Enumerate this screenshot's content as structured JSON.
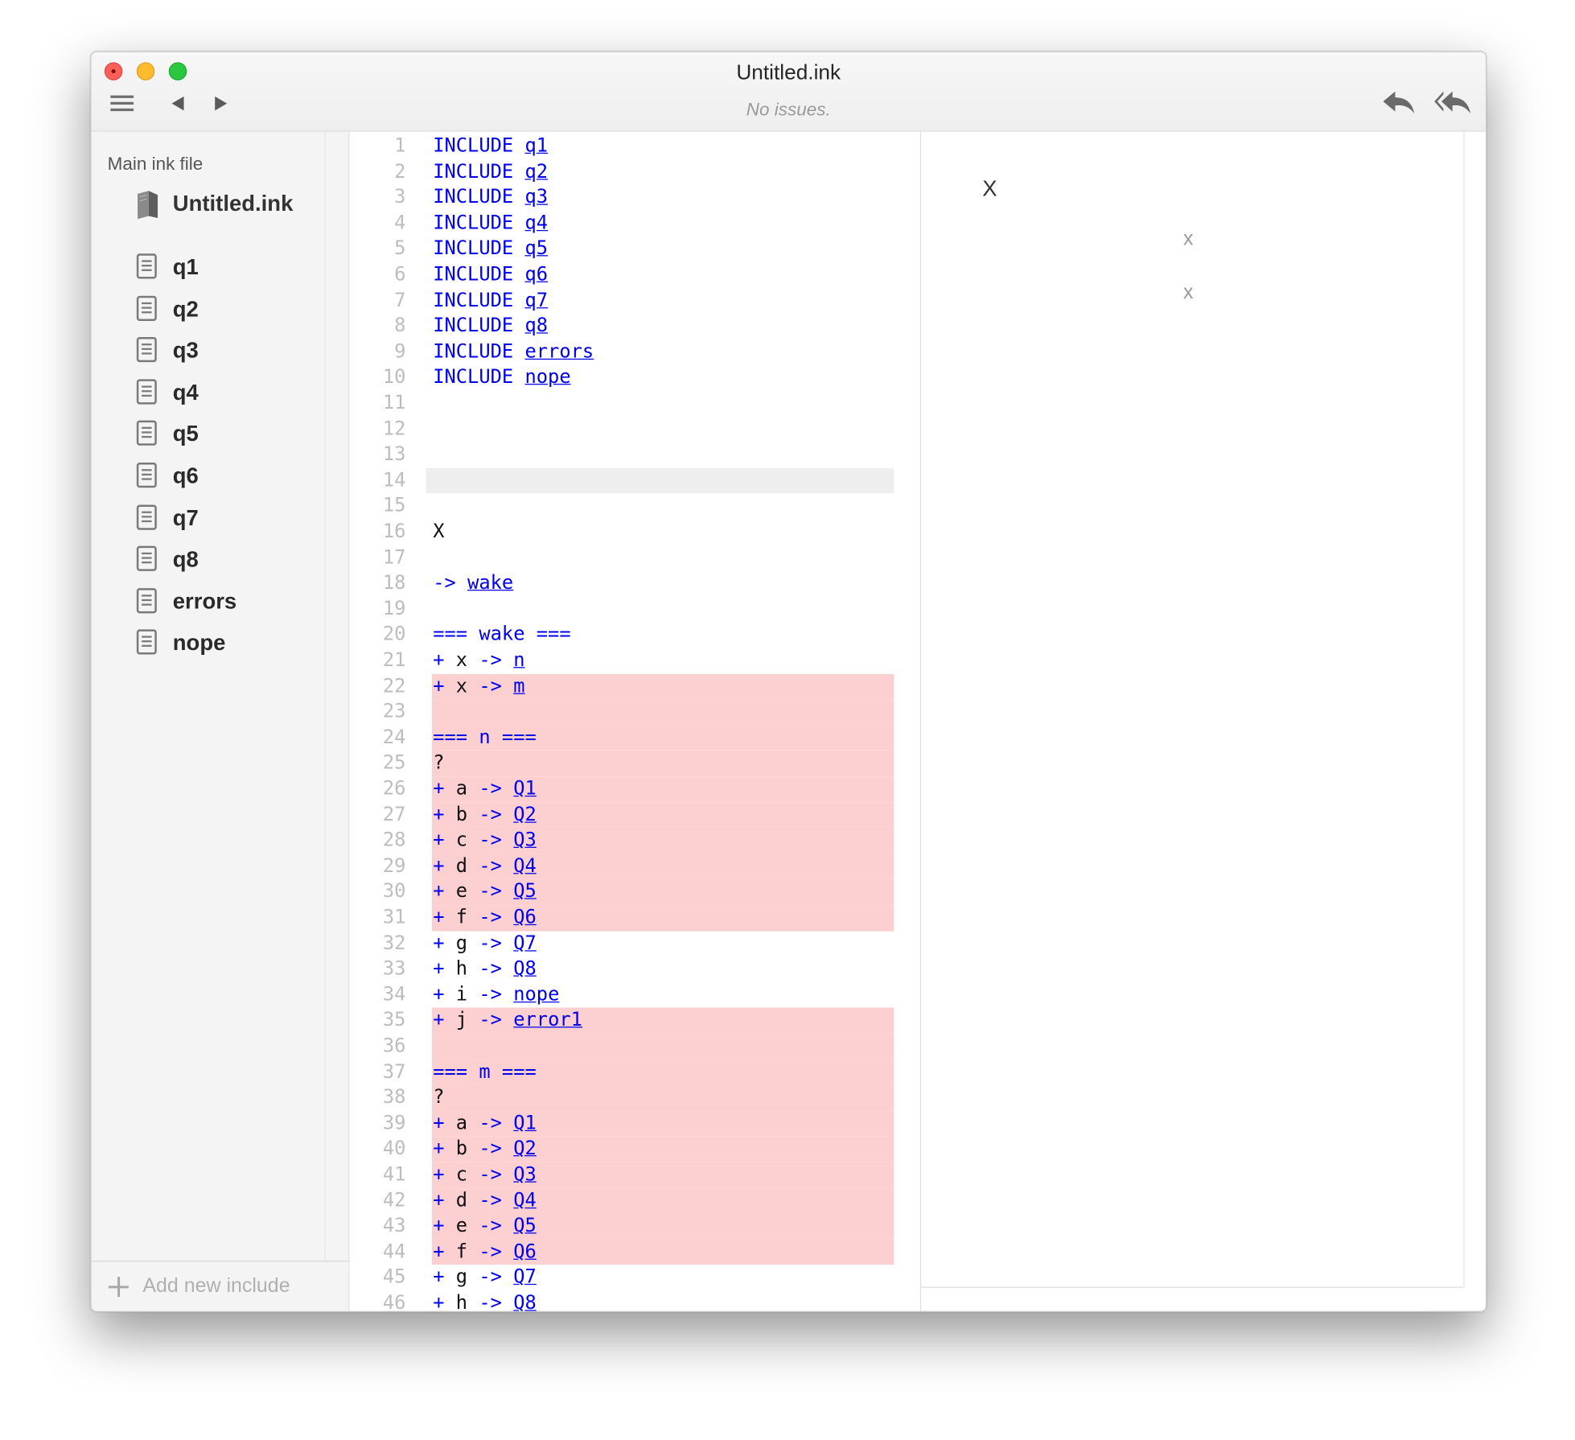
{
  "window": {
    "title": "Untitled.ink",
    "status": "No issues."
  },
  "toolbar": {
    "menu_icon": "hamburger-icon",
    "back_icon": "triangle-left-icon",
    "forward_icon": "triangle-right-icon",
    "rewind_one_icon": "undo-arrow-icon",
    "rewind_all_icon": "double-undo-arrow-icon"
  },
  "sidebar": {
    "heading": "Main ink file",
    "main_file": "Untitled.ink",
    "includes": [
      "q1",
      "q2",
      "q3",
      "q4",
      "q5",
      "q6",
      "q7",
      "q8",
      "errors",
      "nope"
    ],
    "add_label": "Add new include"
  },
  "editor": {
    "lines": [
      {
        "n": "1",
        "seg": [
          [
            "kw",
            "INCLUDE "
          ],
          [
            "lk",
            "q1"
          ]
        ]
      },
      {
        "n": "2",
        "seg": [
          [
            "kw",
            "INCLUDE "
          ],
          [
            "lk",
            "q2"
          ]
        ]
      },
      {
        "n": "3",
        "seg": [
          [
            "kw",
            "INCLUDE "
          ],
          [
            "lk",
            "q3"
          ]
        ]
      },
      {
        "n": "4",
        "seg": [
          [
            "kw",
            "INCLUDE "
          ],
          [
            "lk",
            "q4"
          ]
        ]
      },
      {
        "n": "5",
        "seg": [
          [
            "kw",
            "INCLUDE "
          ],
          [
            "lk",
            "q5"
          ]
        ]
      },
      {
        "n": "6",
        "seg": [
          [
            "kw",
            "INCLUDE "
          ],
          [
            "lk",
            "q6"
          ]
        ]
      },
      {
        "n": "7",
        "seg": [
          [
            "kw",
            "INCLUDE "
          ],
          [
            "lk",
            "q7"
          ]
        ]
      },
      {
        "n": "8",
        "seg": [
          [
            "kw",
            "INCLUDE "
          ],
          [
            "lk",
            "q8"
          ]
        ]
      },
      {
        "n": "9",
        "seg": [
          [
            "kw",
            "INCLUDE "
          ],
          [
            "lk",
            "errors"
          ]
        ]
      },
      {
        "n": "10",
        "seg": [
          [
            "kw",
            "INCLUDE "
          ],
          [
            "lk",
            "nope"
          ]
        ]
      },
      {
        "n": "11",
        "seg": []
      },
      {
        "n": "12",
        "seg": []
      },
      {
        "n": "13",
        "seg": []
      },
      {
        "n": "14",
        "seg": [],
        "current": true
      },
      {
        "n": "15",
        "seg": []
      },
      {
        "n": "16",
        "seg": [
          [
            "tx",
            "X"
          ]
        ]
      },
      {
        "n": "17",
        "seg": []
      },
      {
        "n": "18",
        "seg": [
          [
            "kw",
            "-> "
          ],
          [
            "lk",
            "wake"
          ]
        ]
      },
      {
        "n": "19",
        "seg": []
      },
      {
        "n": "20",
        "seg": [
          [
            "kw",
            "=== wake ==="
          ]
        ]
      },
      {
        "n": "21",
        "seg": [
          [
            "kw",
            "+ "
          ],
          [
            "tx",
            "x "
          ],
          [
            "kw",
            "-> "
          ],
          [
            "lk",
            "n"
          ]
        ]
      },
      {
        "n": "22",
        "seg": [
          [
            "kw",
            "+ "
          ],
          [
            "tx",
            "x "
          ],
          [
            "kw",
            "-> "
          ],
          [
            "lk",
            "m"
          ]
        ],
        "error": true
      },
      {
        "n": "23",
        "seg": [],
        "error": true
      },
      {
        "n": "24",
        "seg": [
          [
            "kw",
            "=== n ==="
          ]
        ],
        "error": true
      },
      {
        "n": "25",
        "seg": [
          [
            "tx",
            "?"
          ]
        ],
        "error": true
      },
      {
        "n": "26",
        "seg": [
          [
            "kw",
            "+ "
          ],
          [
            "tx",
            "a "
          ],
          [
            "kw",
            "-> "
          ],
          [
            "lk",
            "Q1"
          ]
        ],
        "error": true
      },
      {
        "n": "27",
        "seg": [
          [
            "kw",
            "+ "
          ],
          [
            "tx",
            "b "
          ],
          [
            "kw",
            "-> "
          ],
          [
            "lk",
            "Q2"
          ]
        ],
        "error": true
      },
      {
        "n": "28",
        "seg": [
          [
            "kw",
            "+ "
          ],
          [
            "tx",
            "c "
          ],
          [
            "kw",
            "-> "
          ],
          [
            "lk",
            "Q3"
          ]
        ],
        "error": true
      },
      {
        "n": "29",
        "seg": [
          [
            "kw",
            "+ "
          ],
          [
            "tx",
            "d "
          ],
          [
            "kw",
            "-> "
          ],
          [
            "lk",
            "Q4"
          ]
        ],
        "error": true
      },
      {
        "n": "30",
        "seg": [
          [
            "kw",
            "+ "
          ],
          [
            "tx",
            "e "
          ],
          [
            "kw",
            "-> "
          ],
          [
            "lk",
            "Q5"
          ]
        ],
        "error": true
      },
      {
        "n": "31",
        "seg": [
          [
            "kw",
            "+ "
          ],
          [
            "tx",
            "f "
          ],
          [
            "kw",
            "-> "
          ],
          [
            "lk",
            "Q6"
          ]
        ],
        "error": true
      },
      {
        "n": "32",
        "seg": [
          [
            "kw",
            "+ "
          ],
          [
            "tx",
            "g "
          ],
          [
            "kw",
            "-> "
          ],
          [
            "lk",
            "Q7"
          ]
        ]
      },
      {
        "n": "33",
        "seg": [
          [
            "kw",
            "+ "
          ],
          [
            "tx",
            "h "
          ],
          [
            "kw",
            "-> "
          ],
          [
            "lk",
            "Q8"
          ]
        ]
      },
      {
        "n": "34",
        "seg": [
          [
            "kw",
            "+ "
          ],
          [
            "tx",
            "i "
          ],
          [
            "kw",
            "-> "
          ],
          [
            "lk",
            "nope"
          ]
        ]
      },
      {
        "n": "35",
        "seg": [
          [
            "kw",
            "+ "
          ],
          [
            "tx",
            "j "
          ],
          [
            "kw",
            "-> "
          ],
          [
            "lk",
            "error1"
          ]
        ],
        "error": true
      },
      {
        "n": "36",
        "seg": [],
        "error": true
      },
      {
        "n": "37",
        "seg": [
          [
            "kw",
            "=== m ==="
          ]
        ],
        "error": true
      },
      {
        "n": "38",
        "seg": [
          [
            "tx",
            "?"
          ]
        ],
        "error": true
      },
      {
        "n": "39",
        "seg": [
          [
            "kw",
            "+ "
          ],
          [
            "tx",
            "a "
          ],
          [
            "kw",
            "-> "
          ],
          [
            "lk",
            "Q1"
          ]
        ],
        "error": true
      },
      {
        "n": "40",
        "seg": [
          [
            "kw",
            "+ "
          ],
          [
            "tx",
            "b "
          ],
          [
            "kw",
            "-> "
          ],
          [
            "lk",
            "Q2"
          ]
        ],
        "error": true
      },
      {
        "n": "41",
        "seg": [
          [
            "kw",
            "+ "
          ],
          [
            "tx",
            "c "
          ],
          [
            "kw",
            "-> "
          ],
          [
            "lk",
            "Q3"
          ]
        ],
        "error": true
      },
      {
        "n": "42",
        "seg": [
          [
            "kw",
            "+ "
          ],
          [
            "tx",
            "d "
          ],
          [
            "kw",
            "-> "
          ],
          [
            "lk",
            "Q4"
          ]
        ],
        "error": true
      },
      {
        "n": "43",
        "seg": [
          [
            "kw",
            "+ "
          ],
          [
            "tx",
            "e "
          ],
          [
            "kw",
            "-> "
          ],
          [
            "lk",
            "Q5"
          ]
        ],
        "error": true
      },
      {
        "n": "44",
        "seg": [
          [
            "kw",
            "+ "
          ],
          [
            "tx",
            "f "
          ],
          [
            "kw",
            "-> "
          ],
          [
            "lk",
            "Q6"
          ]
        ],
        "error": true
      },
      {
        "n": "45",
        "seg": [
          [
            "kw",
            "+ "
          ],
          [
            "tx",
            "g "
          ],
          [
            "kw",
            "-> "
          ],
          [
            "lk",
            "Q7"
          ]
        ]
      },
      {
        "n": "46",
        "seg": [
          [
            "kw",
            "+ "
          ],
          [
            "tx",
            "h "
          ],
          [
            "kw",
            "-> "
          ],
          [
            "lk",
            "Q8"
          ]
        ]
      }
    ]
  },
  "player": {
    "story_text": "X",
    "choices": [
      "x",
      "x"
    ]
  },
  "colors": {
    "keyword": "#0000ee",
    "error_highlight": "#fcd0d0",
    "current_line": "#eeeeee",
    "close_button": "#fc5f57",
    "minimize_button": "#fdbc2e",
    "zoom_button": "#29c840"
  }
}
